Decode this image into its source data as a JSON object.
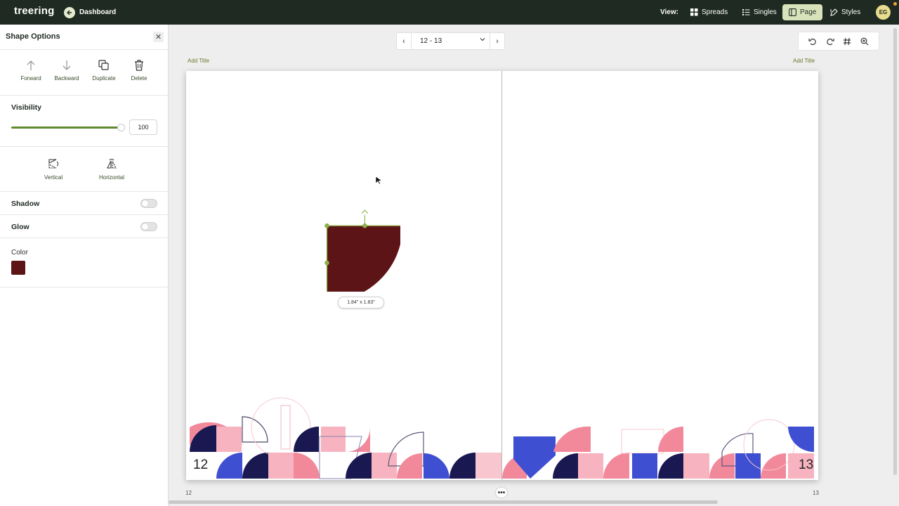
{
  "app": {
    "logo": "treering",
    "back_label": "Dashboard"
  },
  "view": {
    "label": "View:",
    "options": [
      {
        "label": "Spreads",
        "icon": "grid-icon"
      },
      {
        "label": "Singles",
        "icon": "list-icon"
      },
      {
        "label": "Page",
        "icon": "page-icon",
        "active": true
      },
      {
        "label": "Styles",
        "icon": "brush-icon"
      }
    ]
  },
  "user": {
    "initials": "EG"
  },
  "panel": {
    "title": "Shape Options",
    "actions": [
      "Forward",
      "Backward",
      "Duplicate",
      "Delete"
    ],
    "visibility": {
      "label": "Visibility",
      "value": "100",
      "percent": 100
    },
    "flip": [
      "Vertical",
      "Horizontal"
    ],
    "shadow": {
      "label": "Shadow",
      "on": false
    },
    "glow": {
      "label": "Glow",
      "on": false
    },
    "color": {
      "label": "Color",
      "value": "#5c1416"
    }
  },
  "pager": {
    "value": "12 - 13"
  },
  "spread": {
    "left_title": "Add Title",
    "right_title": "Add Title",
    "left_page": "12",
    "right_page": "13",
    "selection_size": "1.84\" x 1.83\""
  },
  "footer": {
    "left_num": "12",
    "right_num": "13"
  },
  "colors": {
    "topbar": "#1f2a22",
    "accent": "#5f8a2e",
    "shape": "#5c1416",
    "active_tab": "#d9e3bb"
  }
}
